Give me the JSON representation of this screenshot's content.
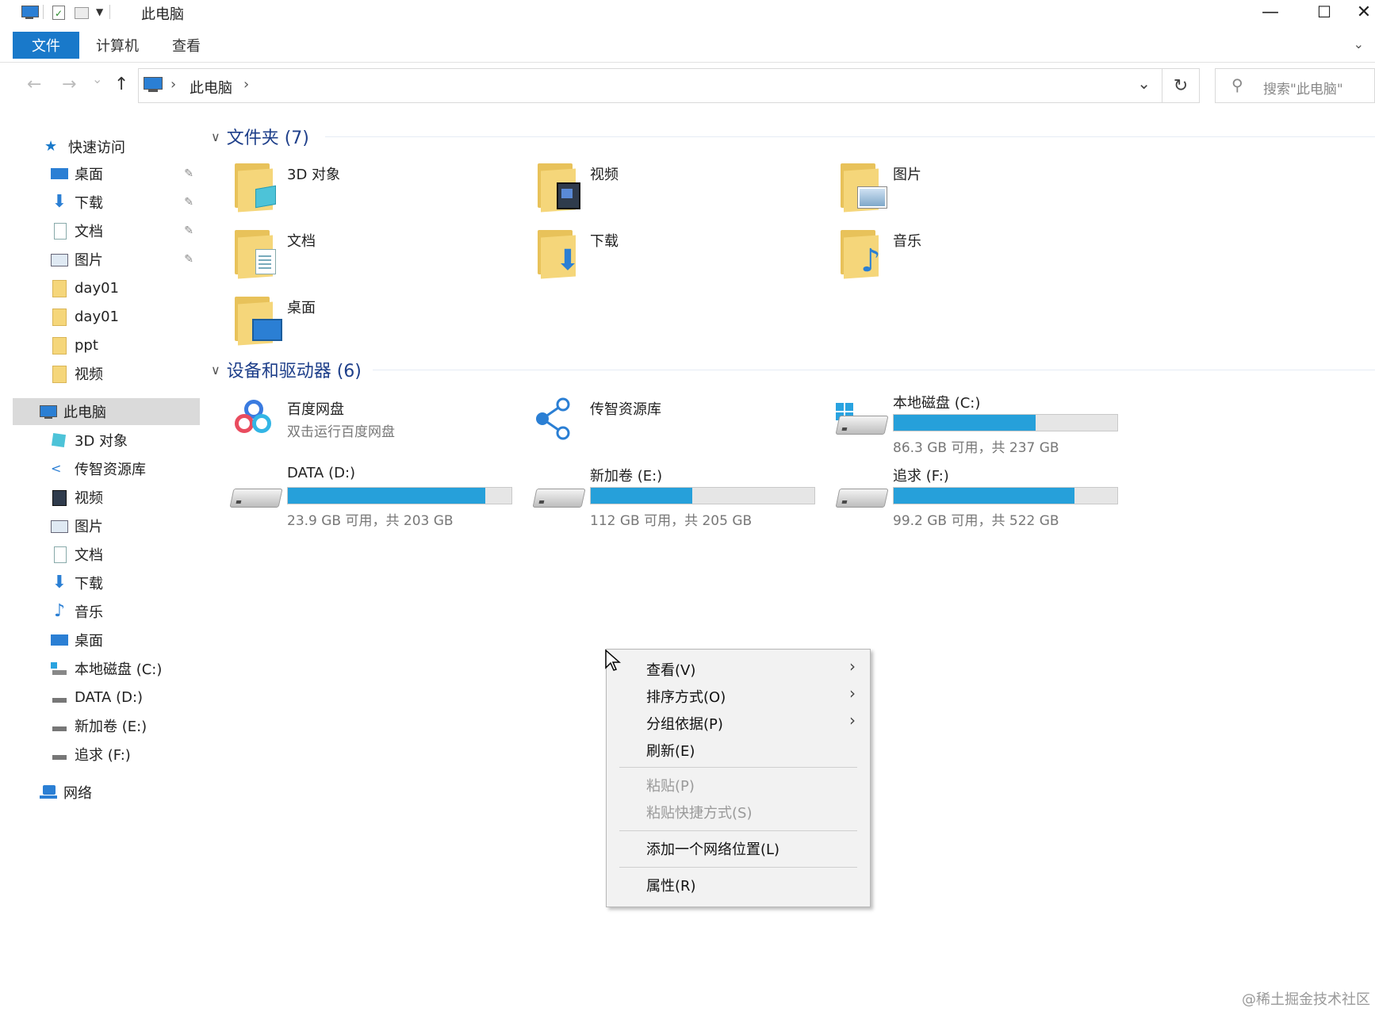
{
  "window": {
    "title": "此电脑",
    "minimize": "—",
    "maximize": "☐",
    "close": "✕"
  },
  "ribbon": {
    "tabs": [
      "文件",
      "计算机",
      "查看"
    ],
    "collapse_icon": "chevron-down-icon"
  },
  "navigation": {
    "back": "←",
    "forward": "→",
    "recent": "⌄",
    "up": "↑",
    "breadcrumb": [
      "此电脑"
    ],
    "separator": "›",
    "dropdown": "⌄",
    "refresh": "↻",
    "search_placeholder": "搜索\"此电脑\""
  },
  "sidebar": {
    "quick_access": "快速访问",
    "quick_items": [
      {
        "label": "桌面",
        "icon": "desktop-icon",
        "pinned": true
      },
      {
        "label": "下载",
        "icon": "download-icon",
        "pinned": true
      },
      {
        "label": "文档",
        "icon": "document-icon",
        "pinned": true
      },
      {
        "label": "图片",
        "icon": "picture-icon",
        "pinned": true
      },
      {
        "label": "day01",
        "icon": "folder-icon",
        "pinned": false
      },
      {
        "label": "day01",
        "icon": "folder-icon",
        "pinned": false
      },
      {
        "label": "ppt",
        "icon": "folder-icon",
        "pinned": false
      },
      {
        "label": "视频",
        "icon": "folder-icon",
        "pinned": false
      }
    ],
    "this_pc": "此电脑",
    "pc_items": [
      {
        "label": "3D 对象",
        "icon": "3d-objects-icon"
      },
      {
        "label": "传智资源库",
        "icon": "share-icon"
      },
      {
        "label": "视频",
        "icon": "video-icon"
      },
      {
        "label": "图片",
        "icon": "picture-icon"
      },
      {
        "label": "文档",
        "icon": "document-icon"
      },
      {
        "label": "下载",
        "icon": "download-icon"
      },
      {
        "label": "音乐",
        "icon": "music-icon"
      },
      {
        "label": "桌面",
        "icon": "desktop-icon"
      },
      {
        "label": "本地磁盘 (C:)",
        "icon": "system-drive-icon"
      },
      {
        "label": "DATA (D:)",
        "icon": "drive-icon"
      },
      {
        "label": "新加卷 (E:)",
        "icon": "drive-icon"
      },
      {
        "label": "追求 (F:)",
        "icon": "drive-icon"
      }
    ],
    "network": "网络",
    "pin_glyph": "📌"
  },
  "folders_group": {
    "title": "文件夹 (7)",
    "items": [
      {
        "label": "3D 对象",
        "icon": "3d-objects-folder-icon"
      },
      {
        "label": "视频",
        "icon": "video-folder-icon"
      },
      {
        "label": "图片",
        "icon": "pictures-folder-icon"
      },
      {
        "label": "文档",
        "icon": "documents-folder-icon"
      },
      {
        "label": "下载",
        "icon": "downloads-folder-icon"
      },
      {
        "label": "音乐",
        "icon": "music-folder-icon"
      },
      {
        "label": "桌面",
        "icon": "desktop-folder-icon"
      }
    ]
  },
  "devices_group": {
    "title": "设备和驱动器 (6)",
    "items": [
      {
        "label": "百度网盘",
        "subtitle": "双击运行百度网盘",
        "icon": "baidu-netdisk-icon",
        "type": "app"
      },
      {
        "label": "传智资源库",
        "subtitle": "",
        "icon": "share-icon",
        "type": "app"
      },
      {
        "label": "本地磁盘 (C:)",
        "subtitle": "86.3 GB 可用，共 237 GB",
        "icon": "system-drive-icon",
        "type": "drive",
        "used_fraction": 0.636
      },
      {
        "label": "DATA (D:)",
        "subtitle": "23.9 GB 可用，共 203 GB",
        "icon": "drive-icon",
        "type": "drive",
        "used_fraction": 0.882
      },
      {
        "label": "新加卷 (E:)",
        "subtitle": "112 GB 可用，共 205 GB",
        "icon": "drive-icon",
        "type": "drive",
        "used_fraction": 0.454
      },
      {
        "label": "追求 (F:)",
        "subtitle": "99.2 GB 可用，共 522 GB",
        "icon": "drive-icon",
        "type": "drive",
        "used_fraction": 0.81
      }
    ]
  },
  "context_menu": {
    "items": [
      {
        "label": "查看(V)",
        "submenu": true,
        "disabled": false
      },
      {
        "label": "排序方式(O)",
        "submenu": true,
        "disabled": false
      },
      {
        "label": "分组依据(P)",
        "submenu": true,
        "disabled": false
      },
      {
        "label": "刷新(E)",
        "submenu": false,
        "disabled": false
      },
      {
        "label": "粘贴(P)",
        "submenu": false,
        "disabled": true
      },
      {
        "label": "粘贴快捷方式(S)",
        "submenu": false,
        "disabled": true
      },
      {
        "label": "添加一个网络位置(L)",
        "submenu": false,
        "disabled": false
      },
      {
        "label": "属性(R)",
        "submenu": false,
        "disabled": false
      }
    ],
    "submenu_arrow": "›"
  },
  "watermark": "@稀土掘金技术社区",
  "colors": {
    "accent": "#1979ca",
    "drive_bar": "#26a0da",
    "group_header": "#1e3f8a",
    "folder": "#f5d67a"
  }
}
